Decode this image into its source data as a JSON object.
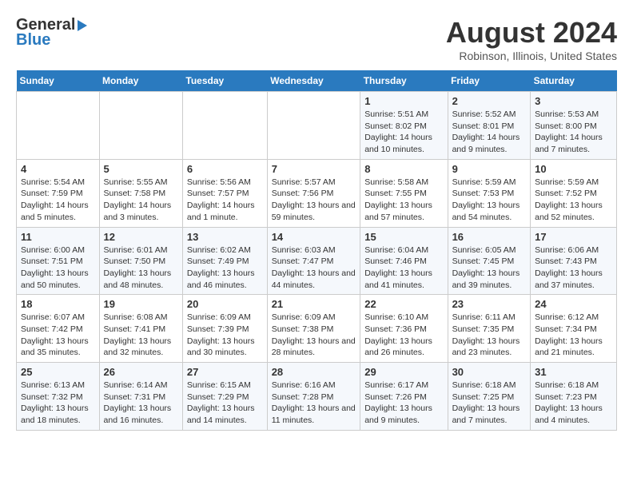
{
  "header": {
    "logo_line1": "General",
    "logo_line2": "Blue",
    "title": "August 2024",
    "subtitle": "Robinson, Illinois, United States"
  },
  "calendar": {
    "weekdays": [
      "Sunday",
      "Monday",
      "Tuesday",
      "Wednesday",
      "Thursday",
      "Friday",
      "Saturday"
    ],
    "weeks": [
      [
        {
          "day": "",
          "info": ""
        },
        {
          "day": "",
          "info": ""
        },
        {
          "day": "",
          "info": ""
        },
        {
          "day": "",
          "info": ""
        },
        {
          "day": "1",
          "info": "Sunrise: 5:51 AM\nSunset: 8:02 PM\nDaylight: 14 hours and 10 minutes."
        },
        {
          "day": "2",
          "info": "Sunrise: 5:52 AM\nSunset: 8:01 PM\nDaylight: 14 hours and 9 minutes."
        },
        {
          "day": "3",
          "info": "Sunrise: 5:53 AM\nSunset: 8:00 PM\nDaylight: 14 hours and 7 minutes."
        }
      ],
      [
        {
          "day": "4",
          "info": "Sunrise: 5:54 AM\nSunset: 7:59 PM\nDaylight: 14 hours and 5 minutes."
        },
        {
          "day": "5",
          "info": "Sunrise: 5:55 AM\nSunset: 7:58 PM\nDaylight: 14 hours and 3 minutes."
        },
        {
          "day": "6",
          "info": "Sunrise: 5:56 AM\nSunset: 7:57 PM\nDaylight: 14 hours and 1 minute."
        },
        {
          "day": "7",
          "info": "Sunrise: 5:57 AM\nSunset: 7:56 PM\nDaylight: 13 hours and 59 minutes."
        },
        {
          "day": "8",
          "info": "Sunrise: 5:58 AM\nSunset: 7:55 PM\nDaylight: 13 hours and 57 minutes."
        },
        {
          "day": "9",
          "info": "Sunrise: 5:59 AM\nSunset: 7:53 PM\nDaylight: 13 hours and 54 minutes."
        },
        {
          "day": "10",
          "info": "Sunrise: 5:59 AM\nSunset: 7:52 PM\nDaylight: 13 hours and 52 minutes."
        }
      ],
      [
        {
          "day": "11",
          "info": "Sunrise: 6:00 AM\nSunset: 7:51 PM\nDaylight: 13 hours and 50 minutes."
        },
        {
          "day": "12",
          "info": "Sunrise: 6:01 AM\nSunset: 7:50 PM\nDaylight: 13 hours and 48 minutes."
        },
        {
          "day": "13",
          "info": "Sunrise: 6:02 AM\nSunset: 7:49 PM\nDaylight: 13 hours and 46 minutes."
        },
        {
          "day": "14",
          "info": "Sunrise: 6:03 AM\nSunset: 7:47 PM\nDaylight: 13 hours and 44 minutes."
        },
        {
          "day": "15",
          "info": "Sunrise: 6:04 AM\nSunset: 7:46 PM\nDaylight: 13 hours and 41 minutes."
        },
        {
          "day": "16",
          "info": "Sunrise: 6:05 AM\nSunset: 7:45 PM\nDaylight: 13 hours and 39 minutes."
        },
        {
          "day": "17",
          "info": "Sunrise: 6:06 AM\nSunset: 7:43 PM\nDaylight: 13 hours and 37 minutes."
        }
      ],
      [
        {
          "day": "18",
          "info": "Sunrise: 6:07 AM\nSunset: 7:42 PM\nDaylight: 13 hours and 35 minutes."
        },
        {
          "day": "19",
          "info": "Sunrise: 6:08 AM\nSunset: 7:41 PM\nDaylight: 13 hours and 32 minutes."
        },
        {
          "day": "20",
          "info": "Sunrise: 6:09 AM\nSunset: 7:39 PM\nDaylight: 13 hours and 30 minutes."
        },
        {
          "day": "21",
          "info": "Sunrise: 6:09 AM\nSunset: 7:38 PM\nDaylight: 13 hours and 28 minutes."
        },
        {
          "day": "22",
          "info": "Sunrise: 6:10 AM\nSunset: 7:36 PM\nDaylight: 13 hours and 26 minutes."
        },
        {
          "day": "23",
          "info": "Sunrise: 6:11 AM\nSunset: 7:35 PM\nDaylight: 13 hours and 23 minutes."
        },
        {
          "day": "24",
          "info": "Sunrise: 6:12 AM\nSunset: 7:34 PM\nDaylight: 13 hours and 21 minutes."
        }
      ],
      [
        {
          "day": "25",
          "info": "Sunrise: 6:13 AM\nSunset: 7:32 PM\nDaylight: 13 hours and 18 minutes."
        },
        {
          "day": "26",
          "info": "Sunrise: 6:14 AM\nSunset: 7:31 PM\nDaylight: 13 hours and 16 minutes."
        },
        {
          "day": "27",
          "info": "Sunrise: 6:15 AM\nSunset: 7:29 PM\nDaylight: 13 hours and 14 minutes."
        },
        {
          "day": "28",
          "info": "Sunrise: 6:16 AM\nSunset: 7:28 PM\nDaylight: 13 hours and 11 minutes."
        },
        {
          "day": "29",
          "info": "Sunrise: 6:17 AM\nSunset: 7:26 PM\nDaylight: 13 hours and 9 minutes."
        },
        {
          "day": "30",
          "info": "Sunrise: 6:18 AM\nSunset: 7:25 PM\nDaylight: 13 hours and 7 minutes."
        },
        {
          "day": "31",
          "info": "Sunrise: 6:18 AM\nSunset: 7:23 PM\nDaylight: 13 hours and 4 minutes."
        }
      ]
    ]
  }
}
